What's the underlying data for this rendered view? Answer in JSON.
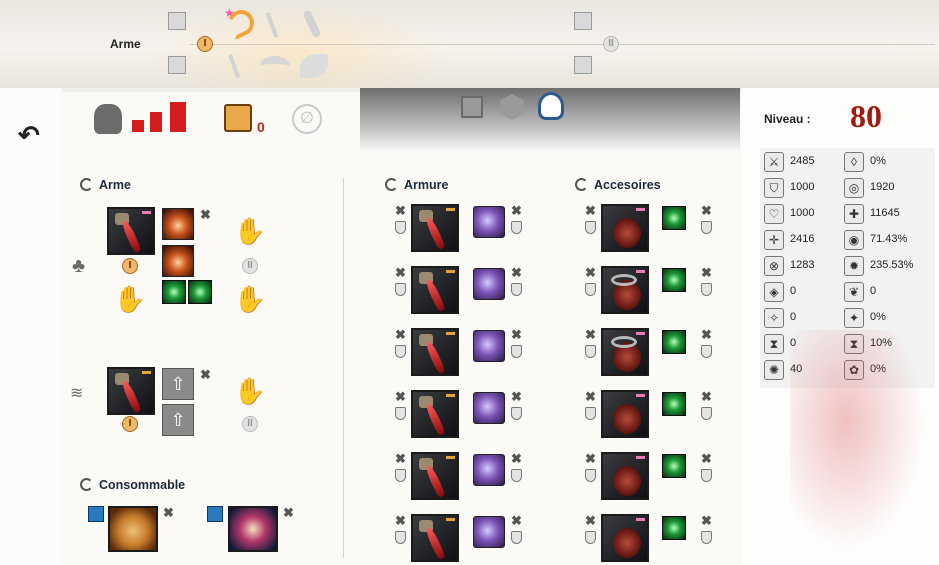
{
  "weapon_bar": {
    "label": "Arme",
    "set1_badge": "I",
    "set2_badge": "II"
  },
  "header": {
    "stat_value": "0",
    "niveau_label": "Niveau :",
    "niveau_value": "80"
  },
  "sections": {
    "arme": "Arme",
    "armure": "Armure",
    "accessoires": "Accesoires",
    "consommable": "Consommable"
  },
  "weapon_sets": [
    {
      "badge": "I",
      "badge2": "II"
    },
    {
      "badge": "I",
      "badge2": "II"
    }
  ],
  "stats": [
    {
      "icon": "sword-icon",
      "glyph": "⚔",
      "value": "2485"
    },
    {
      "icon": "drop-icon",
      "glyph": "◊",
      "value": "0%"
    },
    {
      "icon": "shield-icon",
      "glyph": "⛉",
      "value": "1000"
    },
    {
      "icon": "crest-icon",
      "glyph": "◎",
      "value": "1920"
    },
    {
      "icon": "heart-icon",
      "glyph": "♡",
      "value": "1000"
    },
    {
      "icon": "cross-icon",
      "glyph": "✚",
      "value": "11645"
    },
    {
      "icon": "crosshair-icon",
      "glyph": "✛",
      "value": "2416"
    },
    {
      "icon": "target-icon",
      "glyph": "◉",
      "value": "71.43%"
    },
    {
      "icon": "x-circle-icon",
      "glyph": "⊗",
      "value": "1283"
    },
    {
      "icon": "burst-icon",
      "glyph": "✹",
      "value": "235.53%"
    },
    {
      "icon": "diamond-icon",
      "glyph": "◈",
      "value": "0"
    },
    {
      "icon": "leaf-icon",
      "glyph": "❦",
      "value": "0"
    },
    {
      "icon": "star-diamond-icon",
      "glyph": "✧",
      "value": "0"
    },
    {
      "icon": "star-diamond2-icon",
      "glyph": "✦",
      "value": "0%"
    },
    {
      "icon": "hourglass-icon",
      "glyph": "⧗",
      "value": "0"
    },
    {
      "icon": "hourglass2-icon",
      "glyph": "⧗",
      "value": "10%"
    },
    {
      "icon": "gear-icon",
      "glyph": "✺",
      "value": "40"
    },
    {
      "icon": "flower-icon",
      "glyph": "✿",
      "value": "0%"
    }
  ],
  "colors": {
    "level": "#a11b14",
    "badge": "#f0b76b",
    "rune": "#7c55b8",
    "jewel": "#1e9b38"
  }
}
